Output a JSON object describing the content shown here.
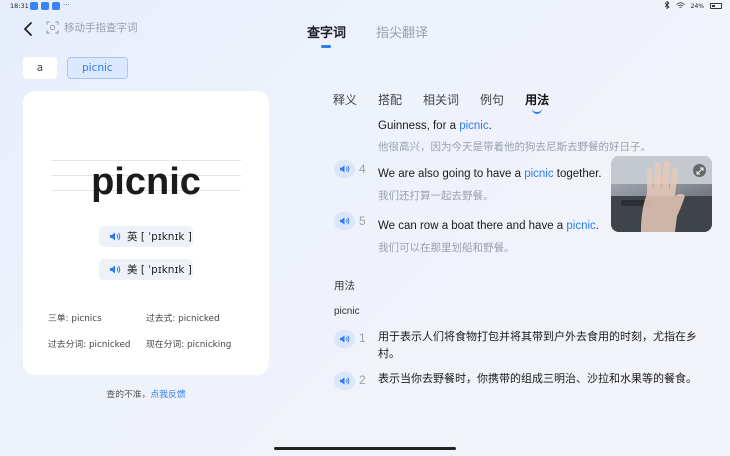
{
  "status": {
    "time": "18:31",
    "battery": "24%"
  },
  "header": {
    "scan_mode_label": "移动手指查字词",
    "tabs": [
      {
        "label": "查字词",
        "active": true
      },
      {
        "label": "指尖翻译",
        "active": false
      }
    ]
  },
  "chips": [
    "a",
    "picnic"
  ],
  "word": {
    "headword": "picnic",
    "pron_uk": "英 [ ˈpɪknɪk ]",
    "pron_us": "美 [ ˈpɪknɪk ]",
    "forms": [
      {
        "label": "三单: picnics",
        "label2": "过去式: picnicked"
      },
      {
        "label": "过去分词: picnicked",
        "label2": "现在分词: picnicking"
      }
    ]
  },
  "feedback": {
    "text": "查的不准，",
    "link": "点我反馈"
  },
  "sub_tabs": [
    {
      "label": "释义",
      "active": false
    },
    {
      "label": "搭配",
      "active": false
    },
    {
      "label": "相关词",
      "active": false
    },
    {
      "label": "例句",
      "active": false
    },
    {
      "label": "用法",
      "active": true
    }
  ],
  "examples": {
    "partial": {
      "en_pre": "Guinness, for a ",
      "en_hl": "picnic",
      "en_post": ".",
      "cn": "他很高兴，因为今天是带着他的狗去尼斯去野餐的好日子。"
    },
    "items": [
      {
        "num": "4",
        "en_pre": "We are also going to have a ",
        "en_hl": "picnic",
        "en_post": " together.",
        "cn": "我们还打算一起去野餐。"
      },
      {
        "num": "5",
        "en_pre": "We can row a boat there and have a ",
        "en_hl": "picnic",
        "en_post": ".",
        "cn": "我们可以在那里划船和野餐。"
      }
    ]
  },
  "usage": {
    "title": "用法",
    "word": "picnic",
    "items": [
      {
        "num": "1",
        "text": "用于表示人们将食物打包并将其带到户外去食用的时刻，尤指在乡村。"
      },
      {
        "num": "2",
        "text": "表示当你去野餐时，你携带的组成三明治、沙拉和水果等的餐食。"
      }
    ]
  },
  "colors": {
    "accent": "#2e7bf6"
  }
}
